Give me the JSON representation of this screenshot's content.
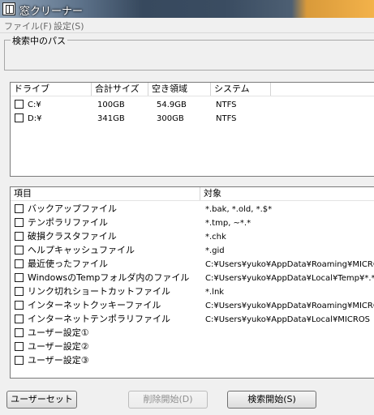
{
  "window": {
    "title": "窓クリーナー"
  },
  "menu": [
    {
      "label": "ファイル(F)"
    },
    {
      "label": "設定(S)"
    }
  ],
  "search_path_group": {
    "label": "検索中のパス",
    "value": ""
  },
  "drives": {
    "columns": [
      "ドライブ",
      "合計サイズ",
      "空き領域",
      "システム"
    ],
    "rows": [
      {
        "drive": "C:¥",
        "total": "100GB",
        "free": "54.9GB",
        "system": "NTFS",
        "checked": false
      },
      {
        "drive": "D:¥",
        "total": "341GB",
        "free": "300GB",
        "system": "NTFS",
        "checked": false
      }
    ]
  },
  "items": {
    "columns": [
      "項目",
      "対象"
    ],
    "rows": [
      {
        "label": "バックアップファイル",
        "target": "*.bak, *.old, *.$*",
        "checked": false
      },
      {
        "label": "テンポラリファイル",
        "target": "*.tmp, ~*.*",
        "checked": false
      },
      {
        "label": "破損クラスタファイル",
        "target": "*.chk",
        "checked": false
      },
      {
        "label": "ヘルプキャッシュファイル",
        "target": "*.gid",
        "checked": false
      },
      {
        "label": "最近使ったファイル",
        "target": "C:¥Users¥yuko¥AppData¥Roaming¥MICRO",
        "checked": false
      },
      {
        "label": "WindowsのTempフォルダ内のファイル",
        "target": "C:¥Users¥yuko¥AppData¥Local¥Temp¥*.*",
        "checked": false
      },
      {
        "label": "リンク切れショートカットファイル",
        "target": "*.lnk",
        "checked": false
      },
      {
        "label": "インターネットクッキーファイル",
        "target": "C:¥Users¥yuko¥AppData¥Roaming¥MICRO",
        "checked": false
      },
      {
        "label": "インターネットテンポラリファイル",
        "target": "C:¥Users¥yuko¥AppData¥Local¥MICROS",
        "checked": false
      },
      {
        "label": "ユーザー設定①",
        "target": "",
        "checked": false
      },
      {
        "label": "ユーザー設定②",
        "target": "",
        "checked": false
      },
      {
        "label": "ユーザー設定③",
        "target": "",
        "checked": false
      }
    ]
  },
  "buttons": {
    "user_set": "ユーザーセット",
    "delete_start": "削除開始(D)",
    "search_start": "検索開始(S)"
  }
}
